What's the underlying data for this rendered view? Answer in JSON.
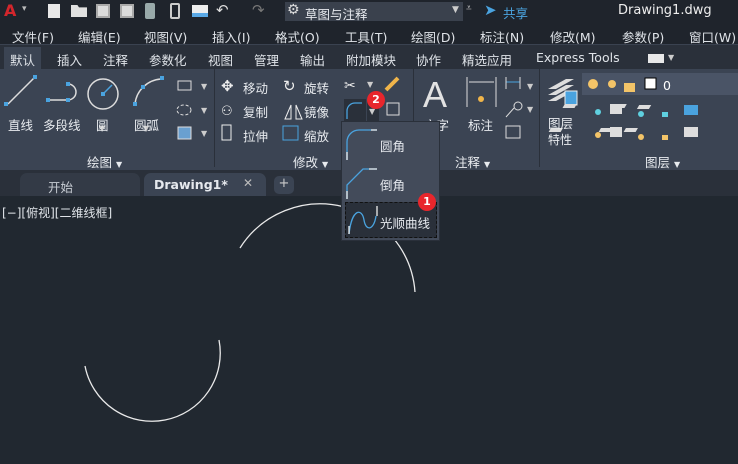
{
  "title_bar": {
    "workspace": "草图与注释",
    "share": "共享",
    "document": "Drawing1.dwg"
  },
  "menu": [
    "文件(F)",
    "编辑(E)",
    "视图(V)",
    "插入(I)",
    "格式(O)",
    "工具(T)",
    "绘图(D)",
    "标注(N)",
    "修改(M)",
    "参数(P)",
    "窗口(W)"
  ],
  "ribbon_tabs": [
    "默认",
    "插入",
    "注释",
    "参数化",
    "视图",
    "管理",
    "输出",
    "附加模块",
    "协作",
    "精选应用",
    "Express Tools"
  ],
  "draw_panel": {
    "line": "直线",
    "polyline": "多段线",
    "circle": "圆",
    "arc": "圆弧",
    "label": "绘图"
  },
  "modify_panel": {
    "move": "移动",
    "rotate": "旋转",
    "copy": "复制",
    "mirror": "镜像",
    "stretch": "拉伸",
    "scale": "缩放",
    "label": "修改"
  },
  "annotation_panel": {
    "text": "文字",
    "dimension": "标注",
    "label": "注释"
  },
  "layers_panel": {
    "properties_line1": "图层",
    "properties_line2": "特性",
    "current_layer": "0",
    "label": "图层"
  },
  "flyout": {
    "fillet": "圆角",
    "chamfer": "倒角",
    "blend": "光顺曲线"
  },
  "badges": {
    "one": "1",
    "two": "2"
  },
  "file_tabs": {
    "start": "开始",
    "drawing": "Drawing1*",
    "close": "✕",
    "add": "+"
  },
  "viewport_label": "[−][俯视][二维线框]",
  "colors": {
    "accent": "#4aa3df",
    "badge": "#e8262c",
    "ribbon": "#3b4453",
    "canvas": "#212830"
  }
}
